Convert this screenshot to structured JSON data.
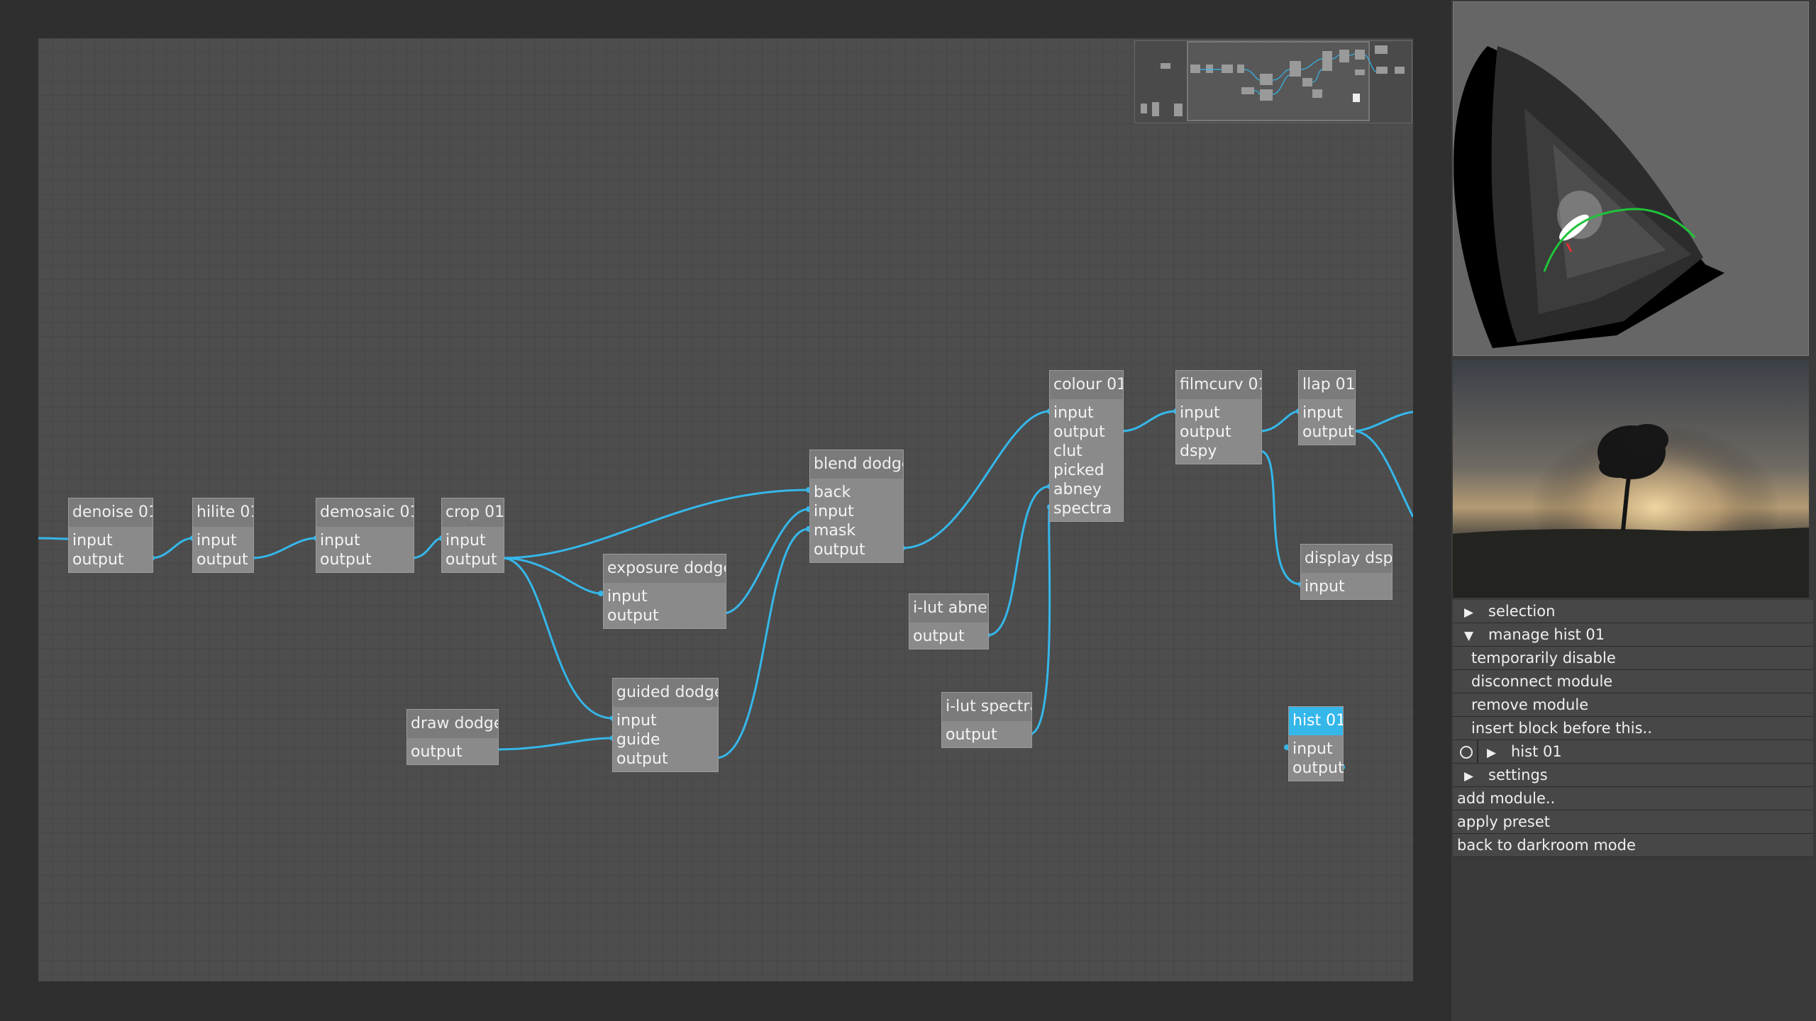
{
  "graph": {
    "nodes": [
      {
        "id": "denoise",
        "title": "denoise 01",
        "connectors": [
          "input",
          "output"
        ]
      },
      {
        "id": "hilite",
        "title": "hilite 01",
        "connectors": [
          "input",
          "output"
        ]
      },
      {
        "id": "demosaic",
        "title": "demosaic 01",
        "connectors": [
          "input",
          "output"
        ]
      },
      {
        "id": "crop",
        "title": "crop 01",
        "connectors": [
          "input",
          "output"
        ]
      },
      {
        "id": "exposure",
        "title": "exposure dodge",
        "connectors": [
          "input",
          "output"
        ]
      },
      {
        "id": "guided",
        "title": "guided dodge",
        "connectors": [
          "input",
          "guide",
          "output"
        ]
      },
      {
        "id": "draw",
        "title": "draw dodge",
        "connectors": [
          "output"
        ]
      },
      {
        "id": "blend",
        "title": "blend dodge",
        "connectors": [
          "back",
          "input",
          "mask",
          "output"
        ]
      },
      {
        "id": "abney",
        "title": "i-lut abney",
        "connectors": [
          "output"
        ]
      },
      {
        "id": "spectra",
        "title": "i-lut spectra",
        "connectors": [
          "output"
        ]
      },
      {
        "id": "colour",
        "title": "colour 01",
        "connectors": [
          "input",
          "output",
          "clut",
          "picked",
          "abney",
          "spectra"
        ]
      },
      {
        "id": "filmcurv",
        "title": "filmcurv 01",
        "connectors": [
          "input",
          "output",
          "dspy"
        ]
      },
      {
        "id": "llap",
        "title": "llap 01",
        "connectors": [
          "input",
          "output"
        ]
      },
      {
        "id": "display",
        "title": "display dspy",
        "connectors": [
          "input"
        ]
      },
      {
        "id": "hist",
        "title": "hist 01",
        "connectors": [
          "input",
          "output"
        ],
        "selected": true
      }
    ],
    "wire_color": "#35b7ea",
    "selected_color": "#35b7ea"
  },
  "menu": {
    "selection": "selection",
    "manage": "manage hist 01",
    "temporarily_disable": "temporarily disable",
    "disconnect": "disconnect module",
    "remove": "remove module",
    "insert_block": "insert block before this..",
    "hist_item": "hist 01",
    "settings": "settings",
    "add_module": "add module..",
    "apply_preset": "apply preset",
    "back": "back to darkroom mode"
  }
}
